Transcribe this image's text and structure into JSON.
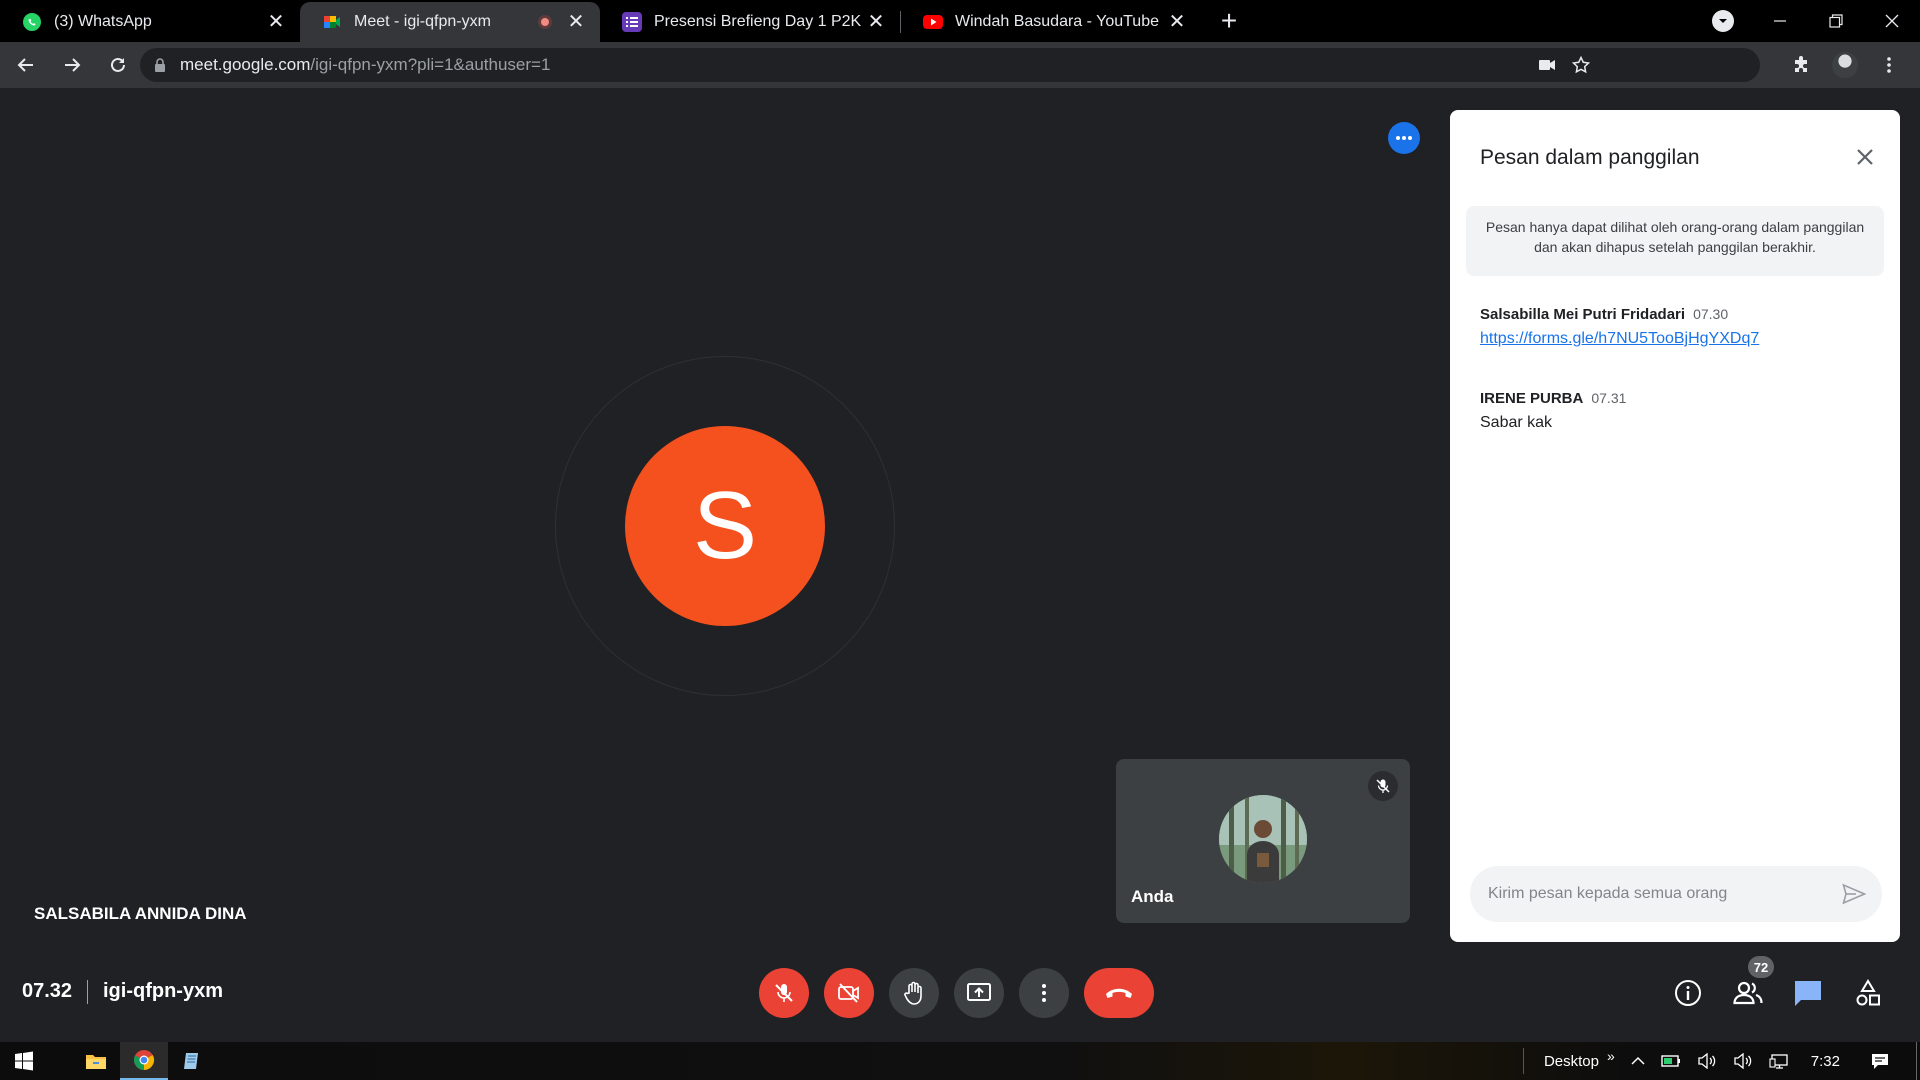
{
  "browser": {
    "tabs": [
      {
        "title": "(3) WhatsApp",
        "icon": "whatsapp-icon",
        "active": false
      },
      {
        "title": "Meet - igi-qfpn-yxm",
        "icon": "meet-icon",
        "active": true,
        "recording": true
      },
      {
        "title": "Presensi Brefieng Day 1 P2K",
        "icon": "forms-icon",
        "active": false
      },
      {
        "title": "Windah Basudara - YouTube",
        "icon": "youtube-icon",
        "active": false
      }
    ],
    "close_glyph": "✕",
    "new_tab_glyph": "+",
    "url_host": "meet.google.com",
    "url_path": "/igi-qfpn-yxm?pli=1&authuser=1"
  },
  "meet": {
    "avatar_letter": "S",
    "avatar_color": "#f4511e",
    "speaker_name": "SALSABILA ANNIDA DINA",
    "self_name": "Anda",
    "time": "07.32",
    "meeting_code": "igi-qfpn-yxm",
    "participant_count": "72"
  },
  "chat": {
    "title": "Pesan dalam panggilan",
    "note": "Pesan hanya dapat dilihat oleh orang-orang dalam panggilan dan akan dihapus setelah panggilan berakhir.",
    "messages": [
      {
        "sender": "Salsabilla Mei Putri Fridadari",
        "time": "07.30",
        "text": "https://forms.gle/h7NU5TooBjHgYXDq7",
        "is_link": true
      },
      {
        "sender": "IRENE PURBA",
        "time": "07.31",
        "text": "Sabar kak",
        "is_link": false
      }
    ],
    "input_placeholder": "Kirim pesan kepada semua orang"
  },
  "taskbar": {
    "desktop_label": "Desktop",
    "chevron": "»",
    "clock": "7:32"
  },
  "colors": {
    "meet_bg": "#202124",
    "danger": "#ea4335",
    "accent": "#1a73e8",
    "tile_bg": "#3c4043"
  }
}
